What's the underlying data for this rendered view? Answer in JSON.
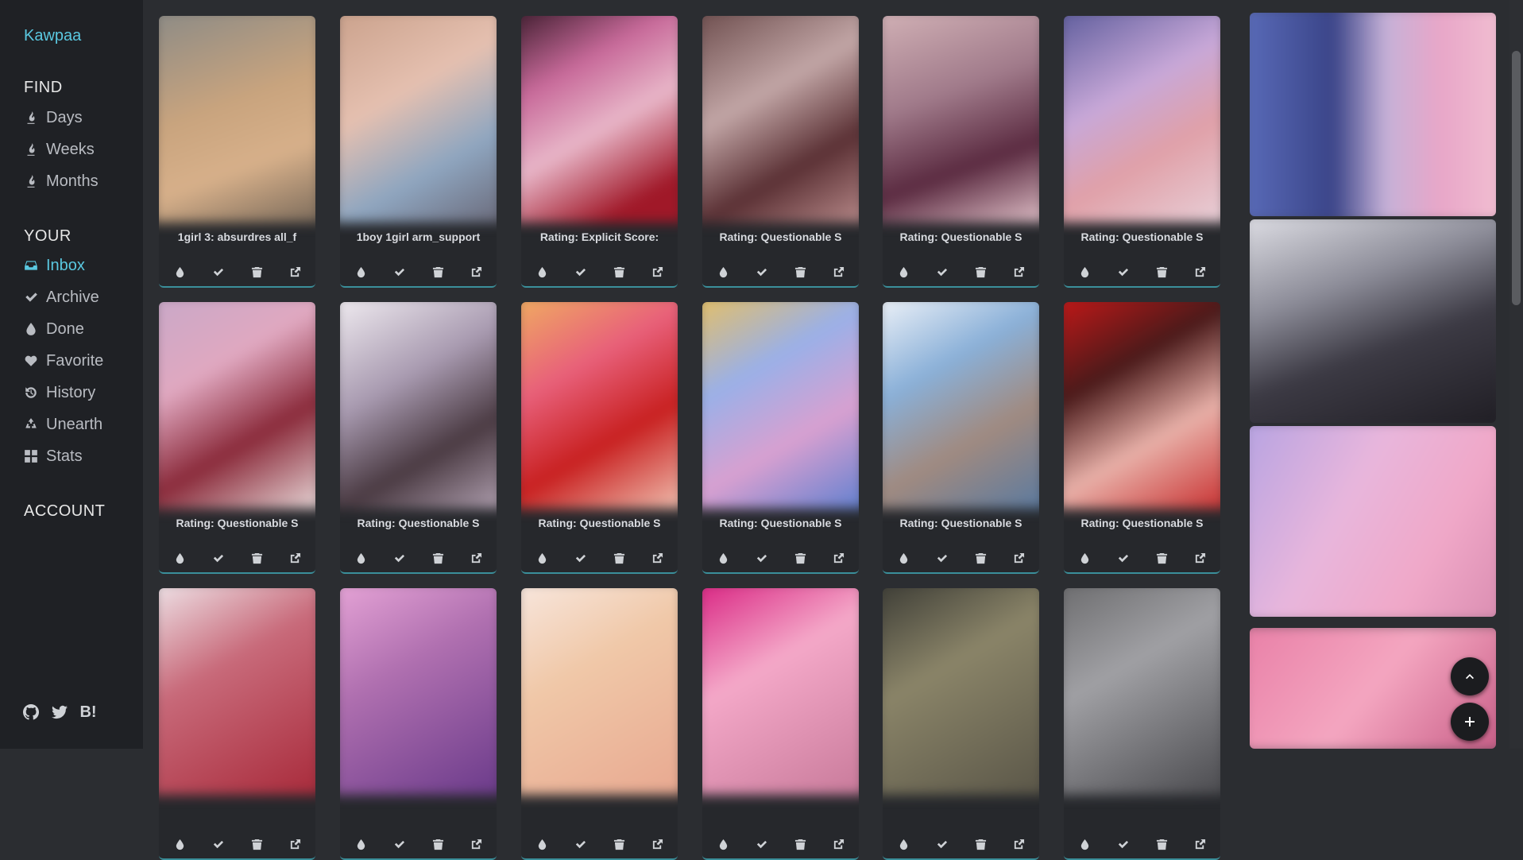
{
  "sidebar": {
    "brand": "Kawpaa",
    "find_title": "FIND",
    "find_items": [
      {
        "label": "Days",
        "icon": "fire-icon"
      },
      {
        "label": "Weeks",
        "icon": "fire-icon"
      },
      {
        "label": "Months",
        "icon": "fire-icon"
      }
    ],
    "your_title": "YOUR",
    "your_items": [
      {
        "label": "Inbox",
        "icon": "inbox-icon",
        "active": true
      },
      {
        "label": "Archive",
        "icon": "check-icon"
      },
      {
        "label": "Done",
        "icon": "drop-icon"
      },
      {
        "label": "Favorite",
        "icon": "heart-icon"
      },
      {
        "label": "History",
        "icon": "history-icon"
      },
      {
        "label": "Unearth",
        "icon": "recycle-icon"
      },
      {
        "label": "Stats",
        "icon": "grid-icon"
      }
    ],
    "account_title": "ACCOUNT",
    "socials": [
      "github-icon",
      "twitter-icon",
      "B!"
    ]
  },
  "cards": [
    {
      "title": "1girl 3: absurdres all_f"
    },
    {
      "title": "1boy 1girl arm_support"
    },
    {
      "title": "Rating: Explicit Score:"
    },
    {
      "title": "Rating: Questionable S"
    },
    {
      "title": "Rating: Questionable S"
    },
    {
      "title": "Rating: Questionable S"
    },
    {
      "title": "Rating: Questionable S"
    },
    {
      "title": "Rating: Questionable S"
    },
    {
      "title": "Rating: Questionable S"
    },
    {
      "title": "Rating: Questionable S"
    },
    {
      "title": "Rating: Questionable S"
    },
    {
      "title": "Rating: Questionable S"
    },
    {
      "title": ""
    },
    {
      "title": ""
    },
    {
      "title": ""
    },
    {
      "title": ""
    },
    {
      "title": ""
    },
    {
      "title": ""
    }
  ],
  "card_actions": [
    "drop-icon",
    "check-icon",
    "trash-icon",
    "external-link-icon"
  ],
  "fabs": [
    "chevron-up-icon",
    "plus-icon"
  ],
  "colors": {
    "accent": "#5ac8e0",
    "sidebar_bg": "#1f2125",
    "page_bg": "#2b2d31"
  }
}
